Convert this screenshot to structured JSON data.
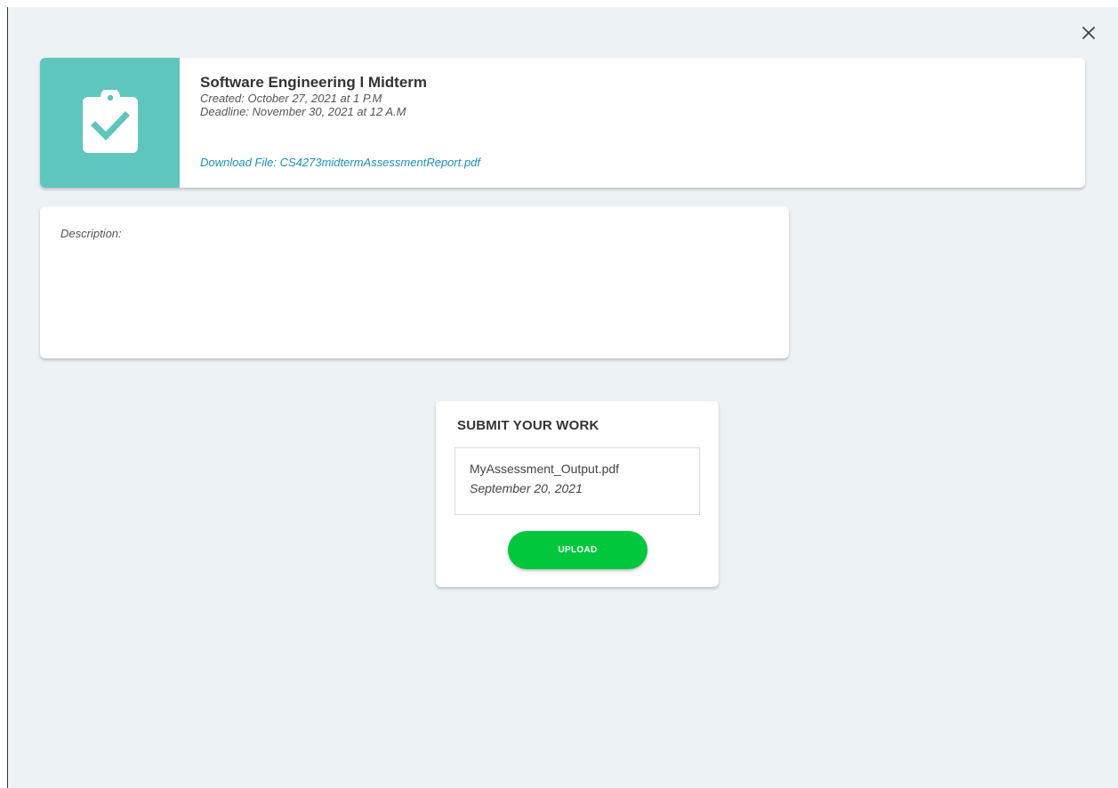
{
  "assignment": {
    "title": "Software Engineering l Midterm",
    "created": "Created: October 27, 2021 at 1 P.M",
    "deadline": "Deadline: November 30, 2021 at 12 A.M",
    "download_link": "Download File: CS4273midtermAssessmentReport.pdf",
    "icon": "clipboard-check-icon",
    "icon_bg_color": "#5ec6bd"
  },
  "description": {
    "label": "Description:"
  },
  "submission": {
    "heading": "SUBMIT YOUR WORK",
    "file_name": "MyAssessment_Output.pdf",
    "file_date": "September 20, 2021",
    "upload_label": "UPLOAD",
    "upload_color": "#00c73c"
  },
  "modal": {
    "close_icon": "close-icon",
    "link_color": "#1a8fc1",
    "background_color": "#edf2f5"
  }
}
